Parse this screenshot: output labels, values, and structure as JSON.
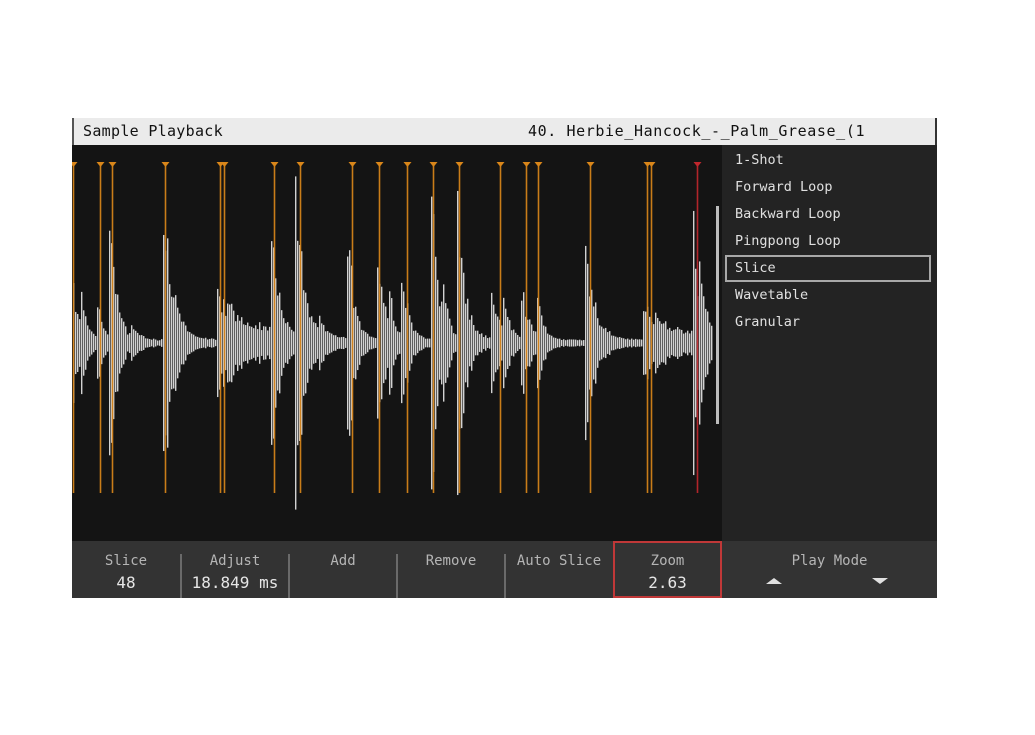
{
  "header": {
    "title": "Sample Playback",
    "file_name": "40. Herbie_Hancock_-_Palm_Grease_(1"
  },
  "play_modes": {
    "items": [
      {
        "label": "1-Shot",
        "selected": false
      },
      {
        "label": "Forward Loop",
        "selected": false
      },
      {
        "label": "Backward Loop",
        "selected": false
      },
      {
        "label": "Pingpong Loop",
        "selected": false
      },
      {
        "label": "Slice",
        "selected": true
      },
      {
        "label": "Wavetable",
        "selected": false
      },
      {
        "label": "Granular",
        "selected": false
      }
    ]
  },
  "bottom_bar": {
    "slice": {
      "label": "Slice",
      "value": "48"
    },
    "adjust": {
      "label": "Adjust",
      "value": "18.849 ms"
    },
    "add": {
      "label": "Add"
    },
    "remove": {
      "label": "Remove"
    },
    "auto_slice": {
      "label": "Auto Slice"
    },
    "zoom": {
      "label": "Zoom",
      "value": "2.63",
      "active": true
    },
    "play_mode": {
      "label": "Play Mode",
      "up_icon": "triangle-up-icon",
      "down_icon": "triangle-down-icon"
    }
  },
  "waveform": {
    "colors": {
      "wave": "#d2d2d2",
      "slice_marker": "#d9861a",
      "selected_marker": "#c0272d",
      "playhead": "#bdbdbd"
    },
    "slice_markers": [
      0.002,
      0.043,
      0.062,
      0.143,
      0.228,
      0.234,
      0.31,
      0.351,
      0.431,
      0.473,
      0.515,
      0.555,
      0.595,
      0.658,
      0.698,
      0.717,
      0.797,
      0.884,
      0.89
    ],
    "selected_slice_marker": 0.961,
    "playhead": 0.993,
    "transients": [
      {
        "pos": 0.0,
        "amp": 0.4,
        "decay": 0.01
      },
      {
        "pos": 0.013,
        "amp": 0.25,
        "decay": 0.008
      },
      {
        "pos": 0.04,
        "amp": 0.25,
        "decay": 0.008
      },
      {
        "pos": 0.058,
        "amp": 0.86,
        "decay": 0.01
      },
      {
        "pos": 0.09,
        "amp": 0.1,
        "decay": 0.01
      },
      {
        "pos": 0.14,
        "amp": 1.0,
        "decay": 0.014
      },
      {
        "pos": 0.222,
        "amp": 0.3,
        "decay": 0.06
      },
      {
        "pos": 0.306,
        "amp": 0.93,
        "decay": 0.01
      },
      {
        "pos": 0.345,
        "amp": 0.9,
        "decay": 0.012
      },
      {
        "pos": 0.38,
        "amp": 0.1,
        "decay": 0.01
      },
      {
        "pos": 0.425,
        "amp": 0.65,
        "decay": 0.01
      },
      {
        "pos": 0.47,
        "amp": 0.52,
        "decay": 0.012
      },
      {
        "pos": 0.488,
        "amp": 0.25,
        "decay": 0.006
      },
      {
        "pos": 0.508,
        "amp": 0.42,
        "decay": 0.01
      },
      {
        "pos": 0.554,
        "amp": 0.9,
        "decay": 0.01
      },
      {
        "pos": 0.572,
        "amp": 0.22,
        "decay": 0.006
      },
      {
        "pos": 0.592,
        "amp": 0.88,
        "decay": 0.012
      },
      {
        "pos": 0.644,
        "amp": 0.45,
        "decay": 0.01
      },
      {
        "pos": 0.664,
        "amp": 0.28,
        "decay": 0.008
      },
      {
        "pos": 0.69,
        "amp": 0.4,
        "decay": 0.012
      },
      {
        "pos": 0.715,
        "amp": 0.28,
        "decay": 0.008
      },
      {
        "pos": 0.79,
        "amp": 0.65,
        "decay": 0.014
      },
      {
        "pos": 0.88,
        "amp": 0.22,
        "decay": 0.05
      },
      {
        "pos": 0.955,
        "amp": 0.84,
        "decay": 0.006
      },
      {
        "pos": 0.965,
        "amp": 0.3,
        "decay": 0.012
      }
    ]
  }
}
